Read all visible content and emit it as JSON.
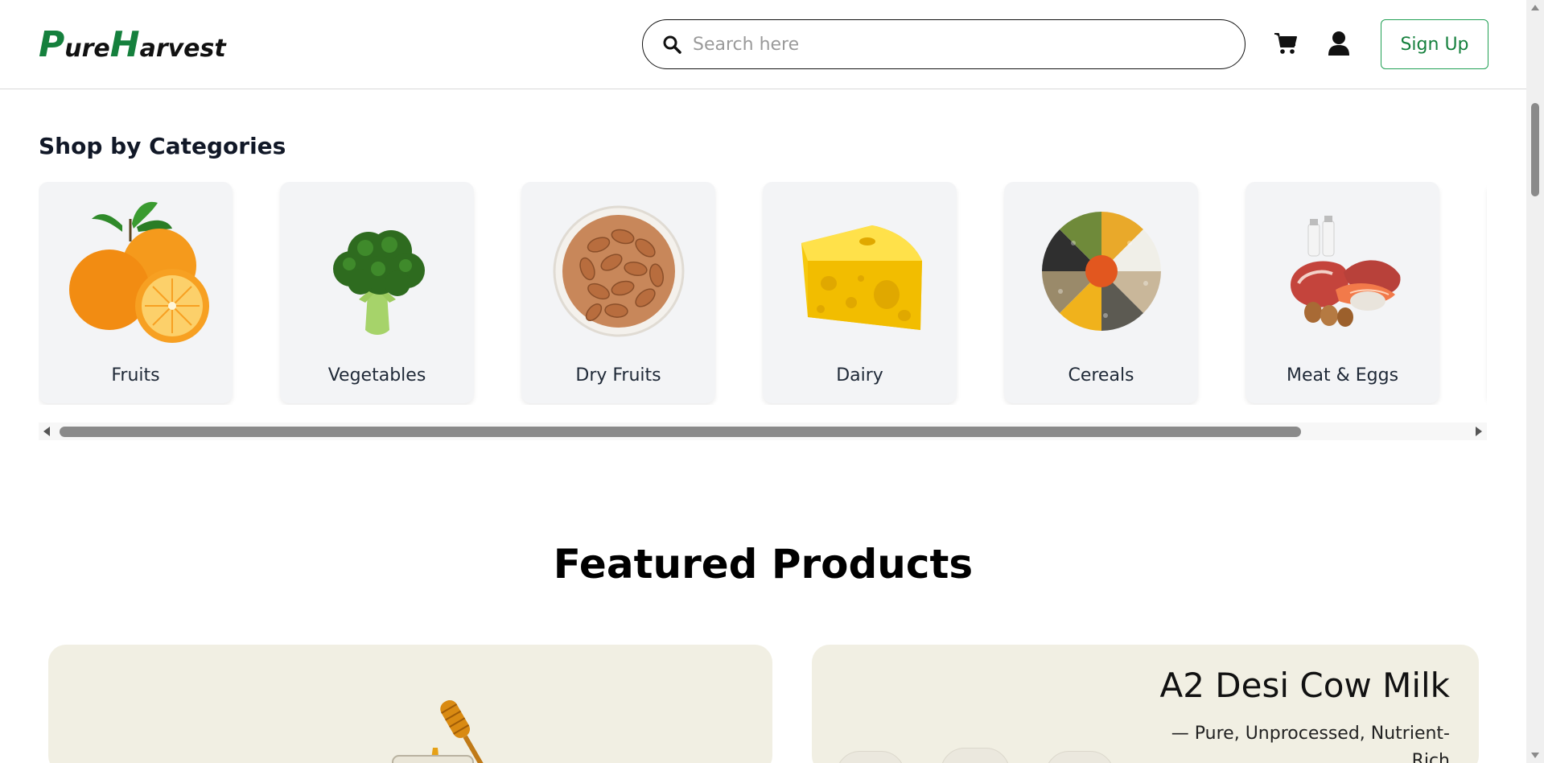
{
  "header": {
    "logo": {
      "p": "P",
      "ure": "ure",
      "h": "H",
      "arvest": "arvest"
    },
    "search_placeholder": "Search here",
    "icons": {
      "search": "search-icon",
      "cart": "cart-icon",
      "user": "user-icon"
    },
    "signup_label": "Sign Up"
  },
  "categories": {
    "title": "Shop by Categories",
    "items": [
      {
        "label": "Fruits",
        "icon": "orange-image"
      },
      {
        "label": "Vegetables",
        "icon": "broccoli-image"
      },
      {
        "label": "Dry Fruits",
        "icon": "almonds-image"
      },
      {
        "label": "Dairy",
        "icon": "cheese-image"
      },
      {
        "label": "Cereals",
        "icon": "grains-image"
      },
      {
        "label": "Meat & Eggs",
        "icon": "meat-eggs-image"
      }
    ]
  },
  "featured": {
    "title": "Featured Products",
    "products": [
      {
        "name": "",
        "image": "honey-jar-image"
      },
      {
        "name": "A2 Desi Cow Milk",
        "description": "— Pure, Unprocessed, Nutrient-Rich"
      }
    ]
  },
  "colors": {
    "brand_green": "#15803d",
    "card_bg": "#f3f4f6",
    "product_bg": "#f1efe3"
  }
}
